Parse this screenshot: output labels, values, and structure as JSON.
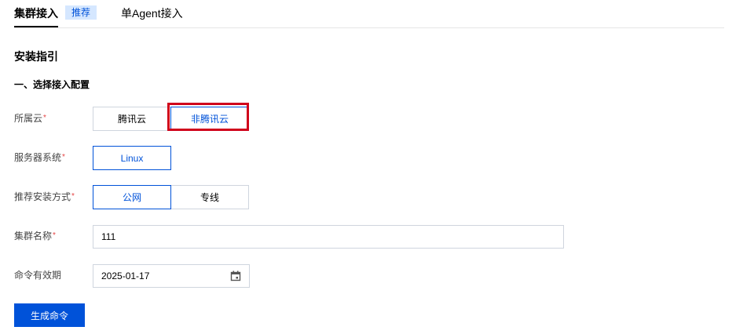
{
  "tabs": {
    "cluster": "集群接入",
    "recommend_badge": "推荐",
    "agent": "单Agent接入"
  },
  "section_title": "安装指引",
  "step_title": "一、选择接入配置",
  "form": {
    "cloud": {
      "label": "所属云",
      "options": [
        "腾讯云",
        "非腾讯云"
      ],
      "selected": "非腾讯云"
    },
    "os": {
      "label": "服务器系统",
      "options": [
        "Linux"
      ],
      "selected": "Linux"
    },
    "install": {
      "label": "推荐安装方式",
      "options": [
        "公网",
        "专线"
      ],
      "selected": "公网"
    },
    "cluster_name": {
      "label": "集群名称",
      "value": "111"
    },
    "expiry": {
      "label": "命令有效期",
      "value": "2025-01-17"
    },
    "required_mark": "*"
  },
  "generate_button": "生成命令",
  "colors": {
    "primary": "#0052d9",
    "highlight": "#d0021b",
    "badge_bg": "#d5e7ff",
    "required": "#e54545"
  }
}
